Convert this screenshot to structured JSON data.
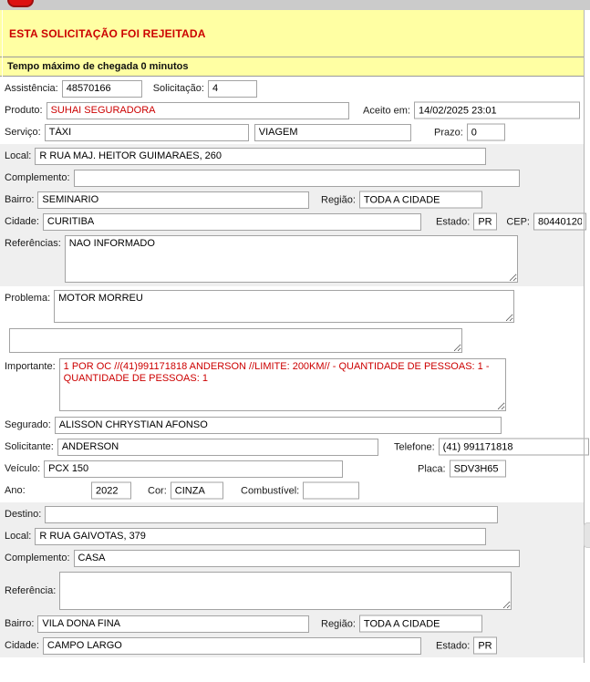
{
  "header": {
    "rejected_banner": "ESTA SOLICITAÇÃO FOI REJEITADA",
    "arrival_banner": "Tempo máximo de chegada 0 minutos"
  },
  "request": {
    "assistencia_label": "Assistência:",
    "assistencia": "48570166",
    "solicitacao_label": "Solicitação:",
    "solicitacao": "4",
    "produto_label": "Produto:",
    "produto": "SUHAI SEGURADORA",
    "aceito_em_label": "Aceito em:",
    "aceito_em": "14/02/2025 23:01",
    "servico_label": "Serviço:",
    "servico": "TÁXI",
    "servico_tipo": "VIAGEM",
    "prazo_label": "Prazo:",
    "prazo": "0"
  },
  "origin": {
    "local_label": "Local:",
    "local": "R RUA MAJ. HEITOR GUIMARAES, 260",
    "complemento_label": "Complemento:",
    "complemento": "",
    "bairro_label": "Bairro:",
    "bairro": "SEMINARIO",
    "regiao_label": "Região:",
    "regiao": "TODA A CIDADE",
    "cidade_label": "Cidade:",
    "cidade": "CURITIBA",
    "estado_label": "Estado:",
    "estado": "PR",
    "cep_label": "CEP:",
    "cep": "80440120",
    "referencias_label": "Referências:",
    "referencias": "NAO INFORMADO"
  },
  "details": {
    "problema_label": "Problema:",
    "problema": "MOTOR MORREU",
    "observacao": "",
    "importante_label": "Importante:",
    "importante": "1 POR OC //(41)991171818 ANDERSON //LIMITE: 200KM// - QUANTIDADE DE PESSOAS: 1 - QUANTIDADE DE PESSOAS: 1",
    "segurado_label": "Segurado:",
    "segurado": "ALISSON CHRYSTIAN AFONSO",
    "solicitante_label": "Solicitante:",
    "solicitante": "ANDERSON",
    "telefone_label": "Telefone:",
    "telefone": "(41) 991171818",
    "veiculo_label": "Veículo:",
    "veiculo": "PCX 150",
    "placa_label": "Placa:",
    "placa": "SDV3H65",
    "ano_label": "Ano:",
    "ano": "2022",
    "cor_label": "Cor:",
    "cor": "CINZA",
    "combustivel_label": "Combustível:",
    "combustivel": ""
  },
  "destination": {
    "destino_label": "Destino:",
    "destino": "",
    "local_label": "Local:",
    "local": "R RUA GAIVOTAS, 379",
    "complemento_label": "Complemento:",
    "complemento": "CASA",
    "referencia_label": "Referência:",
    "referencia": "",
    "bairro_label": "Bairro:",
    "bairro": "VILA DONA FINA",
    "regiao_label": "Região:",
    "regiao": "TODA A CIDADE",
    "cidade_label": "Cidade:",
    "cidade": "CAMPO LARGO",
    "estado_label": "Estado:",
    "estado": "PR"
  },
  "colors": {
    "alert_red": "#cc0000",
    "banner_yellow": "#ffffa3",
    "section_gray": "#efefef",
    "top_strip_gray": "#cbcbcb",
    "pill_red": "#dd1111"
  }
}
